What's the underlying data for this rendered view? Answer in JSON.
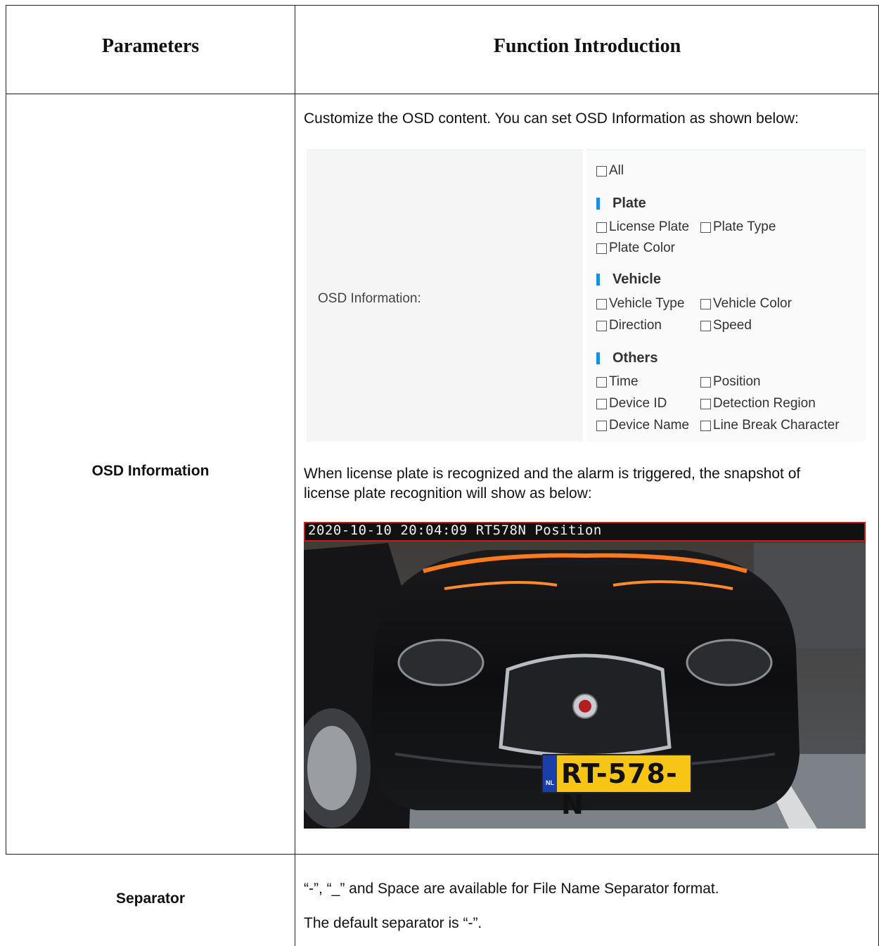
{
  "table": {
    "headers": {
      "parameters": "Parameters",
      "function_introduction": "Function Introduction"
    },
    "rows": [
      {
        "parameter": "OSD Information",
        "intro_text": "Customize the OSD content. You can set OSD Information as shown below:",
        "panel": {
          "label": "OSD Information:",
          "all_option": "All",
          "sections": [
            {
              "title": "Plate",
              "options": [
                "License Plate",
                "Plate Type",
                "Plate Color"
              ]
            },
            {
              "title": "Vehicle",
              "options": [
                "Vehicle Type",
                "Vehicle Color",
                "Direction",
                "Speed"
              ]
            },
            {
              "title": "Others",
              "options": [
                "Time",
                "Position",
                "Device ID",
                "Detection Region",
                "Device Name",
                "Line Break Character"
              ]
            }
          ],
          "accent_color": "#1a8fe0"
        },
        "snapshot_text_line1": "When license plate is recognized and the alarm is triggered, the snapshot of",
        "snapshot_text_line2": "license plate recognition will show as below:",
        "snapshot": {
          "overlay_text": "2020-10-10 20:04:09 RT578N Position",
          "plate_text": "RT-578-N",
          "plate_country": "NL"
        }
      },
      {
        "parameter": "Separator",
        "lines": [
          "“-”, “_” and Space are available for File Name Separator format.",
          "The default separator is “-”."
        ]
      }
    ]
  }
}
